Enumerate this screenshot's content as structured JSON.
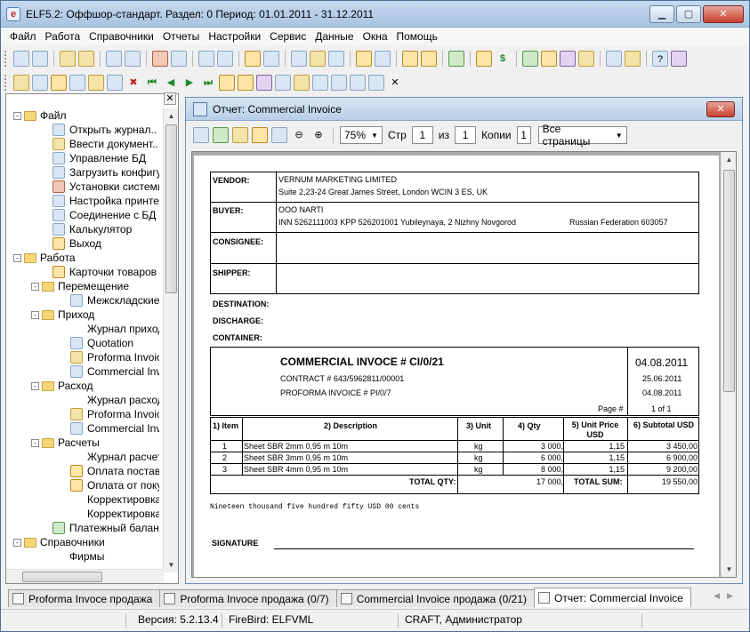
{
  "window": {
    "title": "ELF5.2: Оффшор-стандарт. Раздел: 0 Период: 01.01.2011 - 31.12.2011",
    "icon_letter": "e"
  },
  "menu": [
    "Файл",
    "Работа",
    "Справочники",
    "Отчеты",
    "Настройки",
    "Сервис",
    "Данные",
    "Окна",
    "Помощь"
  ],
  "tree": [
    {
      "label": "Файл",
      "level": 0,
      "type": "folder",
      "exp": "-"
    },
    {
      "label": "Открыть журнал..",
      "level": 1,
      "type": "item",
      "icon": "journal-icon"
    },
    {
      "label": "Ввести документ..",
      "level": 1,
      "type": "item",
      "icon": "document-icon"
    },
    {
      "label": "Управление БД",
      "level": 1,
      "type": "item",
      "icon": "database-icon"
    },
    {
      "label": "Загрузить конфигу",
      "level": 1,
      "type": "item",
      "icon": "load-config-icon"
    },
    {
      "label": "Установки системы",
      "level": 1,
      "type": "item",
      "icon": "tools-icon"
    },
    {
      "label": "Настройка принтер",
      "level": 1,
      "type": "item",
      "icon": "printer-icon"
    },
    {
      "label": "Соединение с БД",
      "level": 1,
      "type": "item",
      "icon": "connection-icon"
    },
    {
      "label": "Калькулятор",
      "level": 1,
      "type": "item",
      "icon": "calculator-icon"
    },
    {
      "label": "Выход",
      "level": 1,
      "type": "item",
      "icon": "exit-icon"
    },
    {
      "label": "Работа",
      "level": 0,
      "type": "folder",
      "exp": "-"
    },
    {
      "label": "Карточки товаров",
      "level": 1,
      "type": "item",
      "icon": "cards-icon"
    },
    {
      "label": "Перемещение",
      "level": 1,
      "type": "folder",
      "exp": "-"
    },
    {
      "label": "Межскладские",
      "level": 2,
      "type": "item",
      "icon": "transfer-icon"
    },
    {
      "label": "Приход",
      "level": 1,
      "type": "folder",
      "exp": "-"
    },
    {
      "label": "Журнал прихода",
      "level": 2,
      "type": "item",
      "icon": "none"
    },
    {
      "label": "Quotation",
      "level": 2,
      "type": "item",
      "icon": "quotation-icon"
    },
    {
      "label": "Proforma Invoice",
      "level": 2,
      "type": "item",
      "icon": "proforma-icon"
    },
    {
      "label": "Commercial Invoi",
      "level": 2,
      "type": "item",
      "icon": "invoice-icon"
    },
    {
      "label": "Расход",
      "level": 1,
      "type": "folder",
      "exp": "-"
    },
    {
      "label": "Журнал расхода",
      "level": 2,
      "type": "item",
      "icon": "none"
    },
    {
      "label": "Proforma Invoice",
      "level": 2,
      "type": "item",
      "icon": "proforma-icon"
    },
    {
      "label": "Commercial Invoi",
      "level": 2,
      "type": "item",
      "icon": "invoice-icon"
    },
    {
      "label": "Расчеты",
      "level": 1,
      "type": "folder",
      "exp": "-"
    },
    {
      "label": "Журнал расчето",
      "level": 2,
      "type": "item",
      "icon": "none"
    },
    {
      "label": "Оплата постави",
      "level": 2,
      "type": "item",
      "icon": "payment-icon"
    },
    {
      "label": "Оплата от покуп",
      "level": 2,
      "type": "item",
      "icon": "payment-icon"
    },
    {
      "label": "Корректировка",
      "level": 2,
      "type": "item",
      "icon": "none"
    },
    {
      "label": "Корректировка",
      "level": 2,
      "type": "item",
      "icon": "none"
    },
    {
      "label": "Платежный баланс",
      "level": 1,
      "type": "item",
      "icon": "balance-icon"
    },
    {
      "label": "Справочники",
      "level": 0,
      "type": "folder",
      "exp": "-"
    },
    {
      "label": "Фирмы",
      "level": 1,
      "type": "item",
      "icon": "none"
    }
  ],
  "report": {
    "title": "Отчет: Commercial Invoice",
    "zoom": "75%",
    "page_label": "Стр",
    "page_value": "1",
    "of_label": "из",
    "of_value": "1",
    "copies_label": "Копии",
    "copies_value": "1",
    "pages_select": "Все страницы"
  },
  "invoice": {
    "vendor_label": "VENDOR:",
    "vendor_name": "VERNUM MARKETING LIMITED",
    "vendor_address": "Suite 2,23-24 Great James Street, London WCIN 3 ES, UK",
    "buyer_label": "BUYER:",
    "buyer_name": "ООО NARTI",
    "buyer_address": "INN 5262111003 KPP 526201001 Yubileynaya, 2 Nizhny Novgorod",
    "buyer_country": "Russian Federation  603057",
    "consignee_label": "CONSIGNEE:",
    "shipper_label": "SHIPPER:",
    "destination_label": "DESTINATION:",
    "discharge_label": "DISCHARGE:",
    "container_label": "CONTAINER:",
    "heading": "COMMERCIAL INVOCE # CI/0/21",
    "heading_date": "04.08.2011",
    "contract": "CONTRACT # 643/5962811/00001",
    "contract_date": "25.06.2011",
    "proforma": "PROFORMA INVOICE # PI/0/7",
    "proforma_date": "04.08.2011",
    "page_label": "Page #",
    "page_value": "1 of 1",
    "columns": [
      "1) Item",
      "2) Description",
      "3) Unit",
      "4) Qty",
      "5) Unit Price USD",
      "6) Subtotal USD"
    ],
    "rows": [
      {
        "item": "1",
        "desc": "Sheet SBR  2mm 0,95 m 10m",
        "unit": "kg",
        "qty": "3 000,",
        "price": "1,15",
        "subtotal": "3 450,00"
      },
      {
        "item": "2",
        "desc": "Sheet SBR 3mm 0,95 m 10m",
        "unit": "kg",
        "qty": "6 000,",
        "price": "1,15",
        "subtotal": "6 900,00"
      },
      {
        "item": "3",
        "desc": "Sheet SBR 4mm 0,95 m 10m",
        "unit": "kg",
        "qty": "8 000,",
        "price": "1,15",
        "subtotal": "9 200,00"
      }
    ],
    "total_qty_label": "TOTAL QTY:",
    "total_qty": "17 000,",
    "total_sum_label": "TOTAL SUM:",
    "total_sum": "19 550,00",
    "amount_words": "Nineteen thousand five hundred fifty USD 00 cents",
    "signature_label": "SIGNATURE"
  },
  "tabs": [
    {
      "label": "Proforma Invoce продажа",
      "active": false
    },
    {
      "label": "Proforma Invoce продажа (0/7)",
      "active": false
    },
    {
      "label": "Commercial Invoice продажа (0/21)",
      "active": false
    },
    {
      "label": "Отчет: Commercial Invoice",
      "active": true
    }
  ],
  "status": {
    "version": "Версия: 5.2.13.4",
    "db": "FireBird: ELFVML",
    "user": "CRAFT, Администратор"
  }
}
